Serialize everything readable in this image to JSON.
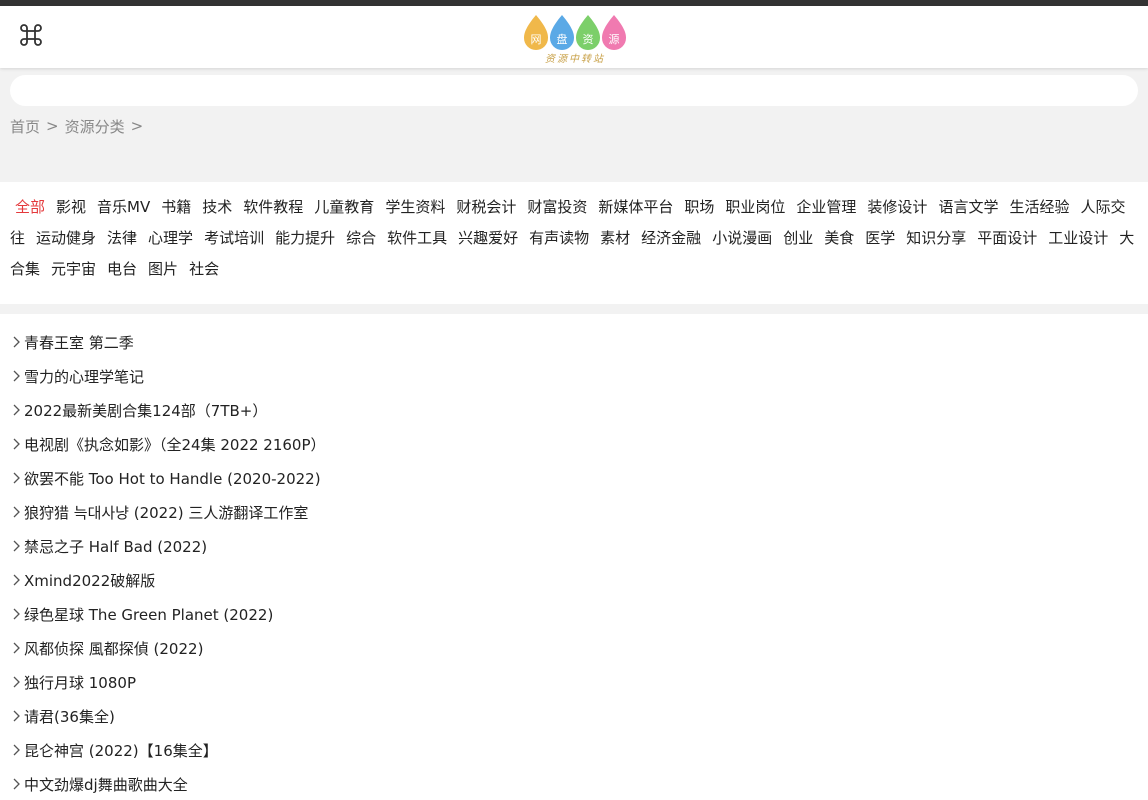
{
  "header": {
    "logo_alt": "网盘资源中转站",
    "logo_chars": [
      "网",
      "盘",
      "资",
      "源"
    ],
    "logo_tagline": "资源中转站",
    "logo_colors": [
      "#f0b84a",
      "#5aa9e6",
      "#7ccf6a",
      "#f07ab0"
    ]
  },
  "search": {
    "placeholder": "",
    "value": ""
  },
  "breadcrumb": {
    "home": "首页",
    "sep1": ">",
    "current": "资源分类",
    "sep2": ">"
  },
  "categories": [
    {
      "label": "全部",
      "active": true
    },
    {
      "label": "影视"
    },
    {
      "label": "音乐MV"
    },
    {
      "label": "书籍"
    },
    {
      "label": "技术"
    },
    {
      "label": "软件教程"
    },
    {
      "label": "儿童教育"
    },
    {
      "label": "学生资料"
    },
    {
      "label": "财税会计"
    },
    {
      "label": "财富投资"
    },
    {
      "label": "新媒体平台"
    },
    {
      "label": "职场"
    },
    {
      "label": "职业岗位"
    },
    {
      "label": "企业管理"
    },
    {
      "label": "装修设计"
    },
    {
      "label": "语言文学"
    },
    {
      "label": "生活经验"
    },
    {
      "label": "人际交往"
    },
    {
      "label": "运动健身"
    },
    {
      "label": "法律"
    },
    {
      "label": "心理学"
    },
    {
      "label": "考试培训"
    },
    {
      "label": "能力提升"
    },
    {
      "label": "综合"
    },
    {
      "label": "软件工具"
    },
    {
      "label": "兴趣爱好"
    },
    {
      "label": "有声读物"
    },
    {
      "label": "素材"
    },
    {
      "label": "经济金融"
    },
    {
      "label": "小说漫画"
    },
    {
      "label": "创业"
    },
    {
      "label": "美食"
    },
    {
      "label": "医学"
    },
    {
      "label": "知识分享"
    },
    {
      "label": "平面设计"
    },
    {
      "label": "工业设计"
    },
    {
      "label": "大合集"
    },
    {
      "label": "元宇宙"
    },
    {
      "label": "电台"
    },
    {
      "label": "图片"
    },
    {
      "label": "社会"
    }
  ],
  "list": [
    "青春王室 第二季",
    "雪力的心理学笔记",
    "2022最新美剧合集124部（7TB+）",
    "电视剧《执念如影》（全24集 2022 2160P）",
    "欲罢不能 Too Hot to Handle (2020-2022)",
    "狼狩猎 늑대사냥 (2022) 三人游翻译工作室",
    "禁忌之子 Half Bad (2022)",
    "Xmind2022破解版",
    "绿色星球 The Green Planet (2022)",
    "风都侦探 風都探偵 (2022)",
    "独行月球 1080P",
    "请君(36集全)",
    "昆仑神宫 (2022)【16集全】",
    "中文劲爆dj舞曲歌曲大全"
  ],
  "colors": {
    "active": "#e4393c",
    "topbar": "#333333",
    "bg_gray": "#f2f2f2"
  },
  "icons": {
    "menu": "command-icon",
    "chevron": "chevron-right-icon"
  }
}
